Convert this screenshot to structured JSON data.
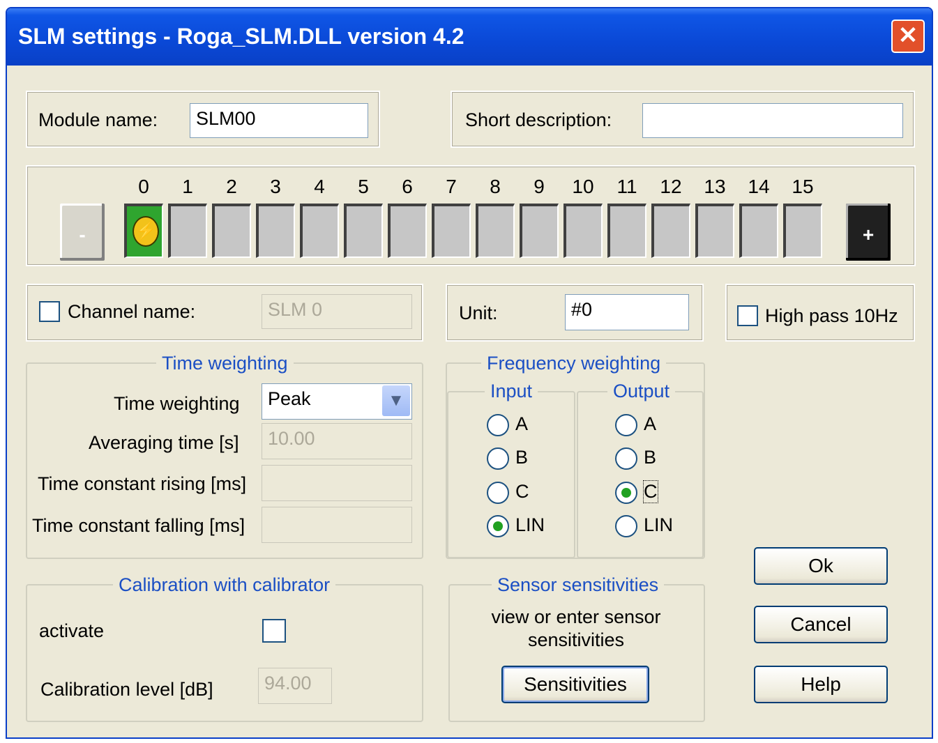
{
  "window": {
    "title": "SLM settings - Roga_SLM.DLL version 4.2",
    "close_label": "✕"
  },
  "module": {
    "label": "Module name:",
    "value": "SLM00"
  },
  "description": {
    "label": "Short description:",
    "value": ""
  },
  "channels": {
    "labels": [
      "0",
      "1",
      "2",
      "3",
      "4",
      "5",
      "6",
      "7",
      "8",
      "9",
      "10",
      "11",
      "12",
      "13",
      "14",
      "15"
    ],
    "active_index": 0,
    "prev_icon": "minus-icon",
    "next_icon": "plus-icon",
    "prev_label": "-",
    "next_label": "+"
  },
  "channel_name": {
    "label": "Channel name:",
    "value": "SLM 0",
    "checked": false
  },
  "unit": {
    "label": "Unit:",
    "value": "#0"
  },
  "high_pass": {
    "label": "High pass 10Hz",
    "checked": false
  },
  "time_weighting": {
    "group_title": "Time weighting",
    "weighting_label": "Time weighting",
    "weighting_value": "Peak",
    "averaging_label": "Averaging time [s]",
    "averaging_value": "10.00",
    "rising_label": "Time constant rising [ms]",
    "rising_value": "",
    "falling_label": "Time constant falling [ms]",
    "falling_value": ""
  },
  "frequency_weighting": {
    "group_title": "Frequency weighting",
    "input_title": "Input",
    "output_title": "Output",
    "options": [
      "A",
      "B",
      "C",
      "LIN"
    ],
    "input_selected": "LIN",
    "output_selected": "C"
  },
  "calibration": {
    "group_title": "Calibration with calibrator",
    "activate_label": "activate",
    "level_label": "Calibration level [dB]",
    "level_value": "94.00"
  },
  "sensors": {
    "group_title": "Sensor sensitivities",
    "description_line1": "view or enter sensor",
    "description_line2": "sensitivities",
    "button_label": "Sensitivities"
  },
  "buttons": {
    "ok": "Ok",
    "cancel": "Cancel",
    "help": "Help"
  },
  "colors": {
    "titlebar": "#0a48d6",
    "group_title": "#1b4fc4",
    "active_channel": "#2fa52f",
    "close": "#e2502a"
  }
}
